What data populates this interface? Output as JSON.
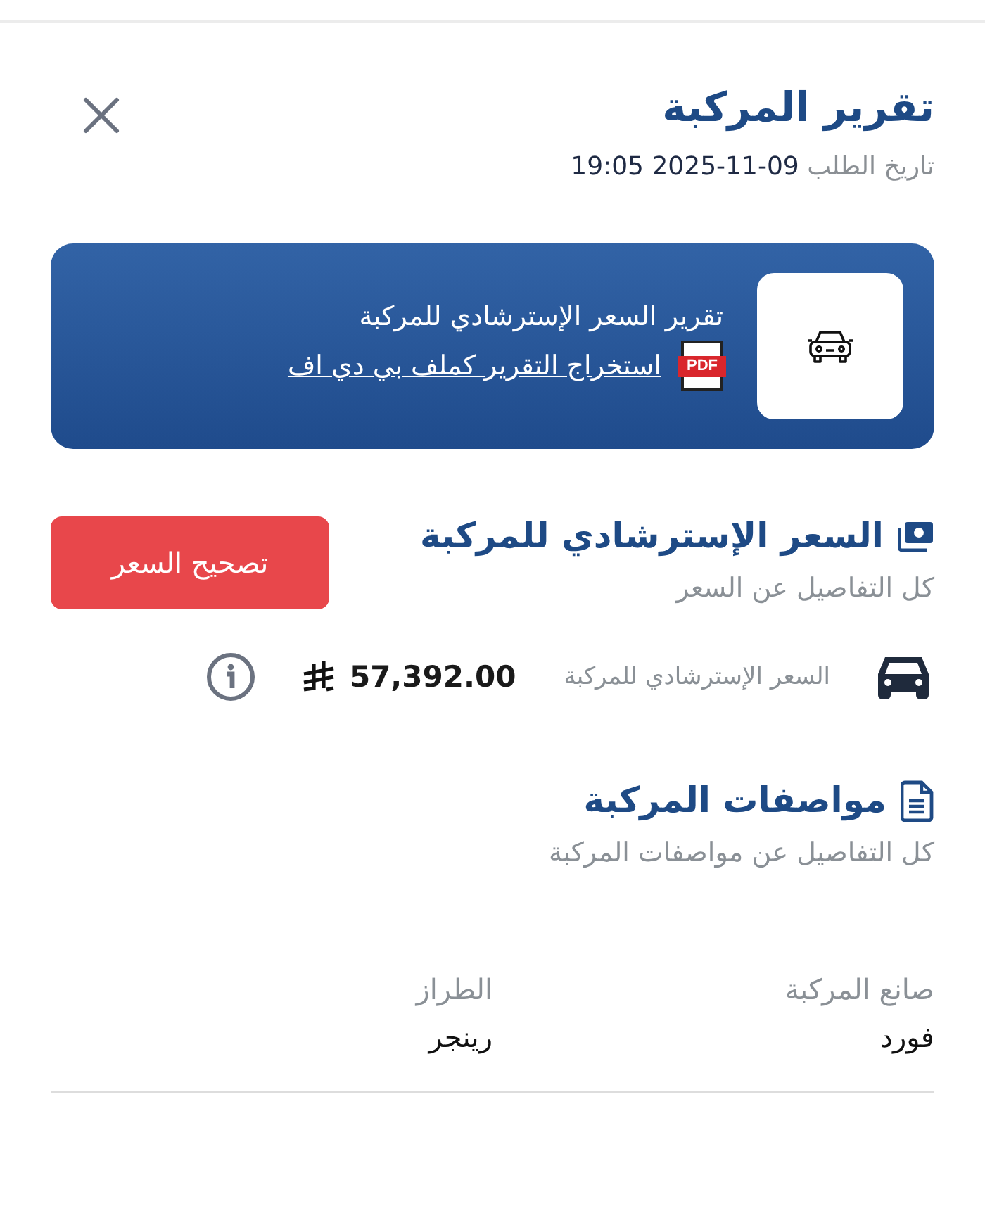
{
  "report": {
    "title": "تقرير المركبة",
    "date_label": "تاريخ الطلب",
    "date_value": "2025-11-09 19:05"
  },
  "banner": {
    "text": "تقرير السعر الإسترشادي للمركبة",
    "link": "استخراج التقرير كملف بي دي اف",
    "file_badge": "PDF"
  },
  "price_section": {
    "title": "السعر الإسترشادي للمركبة",
    "subtitle": "كل التفاصيل عن السعر",
    "button": "تصحيح السعر",
    "label": "السعر الإسترشادي للمركبة",
    "value": "57,392.00"
  },
  "specs_section": {
    "title": "مواصفات المركبة",
    "subtitle": "كل التفاصيل عن مواصفات المركبة",
    "fields": [
      {
        "label": "صانع المركبة",
        "value": "فورد"
      },
      {
        "label": "الطراز",
        "value": "رينجر"
      }
    ]
  }
}
